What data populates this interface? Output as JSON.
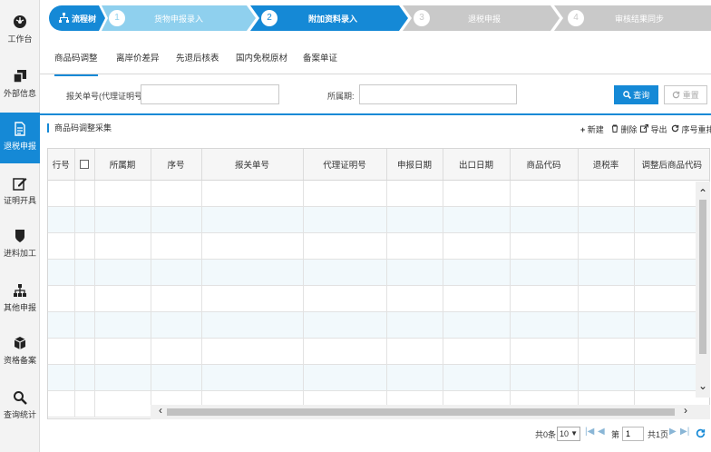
{
  "sidebar": {
    "items": [
      {
        "label": "工作台",
        "icon": "dashboard-icon"
      },
      {
        "label": "外部信息",
        "icon": "external-info-icon"
      },
      {
        "label": "退税申报",
        "icon": "document-icon"
      },
      {
        "label": "证明开具",
        "icon": "edit-icon"
      },
      {
        "label": "进料加工",
        "icon": "shield-icon"
      },
      {
        "label": "其他申报",
        "icon": "org-chart-icon"
      },
      {
        "label": "资格备案",
        "icon": "cube-icon"
      },
      {
        "label": "查询统计",
        "icon": "search-icon"
      }
    ]
  },
  "steps": {
    "flow_label": "流程树",
    "items": [
      {
        "num": "1",
        "label": "货物申报录入"
      },
      {
        "num": "2",
        "label": "附加资料录入"
      },
      {
        "num": "3",
        "label": "退税申报"
      },
      {
        "num": "4",
        "label": "审核结果同步"
      }
    ]
  },
  "tabs": [
    "商品码调整",
    "离岸价差异",
    "先退后核表",
    "国内免税原材",
    "备案单证"
  ],
  "form": {
    "declaration_label": "报关单号(代理证明号):",
    "declaration_value": "",
    "period_label": "所属期:",
    "period_value": "",
    "query_label": "查询",
    "reset_label": "重置"
  },
  "section": {
    "title": "商品码调整采集",
    "actions": {
      "new": "新建",
      "delete": "删除",
      "export": "导出",
      "reorder": "序号重排"
    }
  },
  "table": {
    "columns": [
      "行号",
      "",
      "所属期",
      "序号",
      "报关单号",
      "代理证明号",
      "申报日期",
      "出口日期",
      "商品代码",
      "退税率",
      "调整后商品代码"
    ],
    "rows": []
  },
  "pager": {
    "total_text": "共0条",
    "page_size": "10",
    "page_prefix": "第",
    "current_page": "1",
    "total_pages": "共1页"
  },
  "colors": {
    "accent": "#1589d6",
    "step_inactive": "#c9c9c9",
    "row_alt": "#f2f9fc"
  }
}
